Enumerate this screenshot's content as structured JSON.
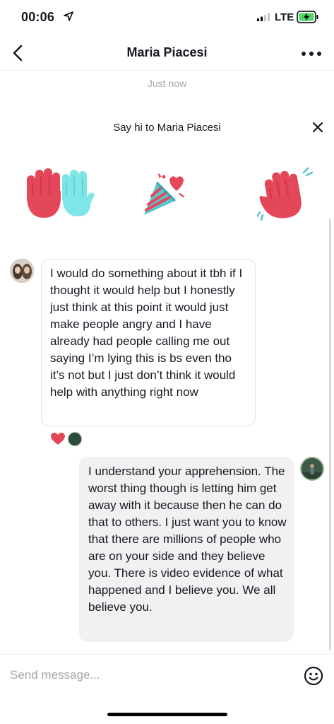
{
  "status_bar": {
    "time": "00:06",
    "network": "LTE",
    "icons": [
      "location-arrow-icon",
      "signal-icon",
      "battery-charging-icon"
    ]
  },
  "header": {
    "title": "Maria Piacesi",
    "back_icon": "chevron-left-icon",
    "more_icon": "ellipsis-icon"
  },
  "conversation": {
    "timestamp": "Just now",
    "say_hi": {
      "text": "Say hi to Maria Piacesi",
      "close_icon": "close-icon",
      "stickers": [
        "high-five-hands-sticker",
        "party-popper-sticker",
        "waving-hand-sticker"
      ]
    },
    "messages": [
      {
        "direction": "incoming",
        "text": "I would do something about it tbh if I thought it would help but I honestly just think at this point it would just make people angry and I have already had people calling me out saying I’m lying this is bs even tho it’s not but I just don’t think it would help with anything right now",
        "reactions": [
          "heart-icon",
          "avatar"
        ]
      },
      {
        "direction": "outgoing",
        "text": "I understand your apprehension. The worst thing though is letting him get away with it because then he can do that to others. I just want you to know that there are millions of people who are on your side and they believe you. There is video evidence of what happened and I believe you. We all believe you."
      }
    ]
  },
  "composer": {
    "placeholder": "Send message...",
    "value": "",
    "emoji_icon": "smiley-icon"
  },
  "colors": {
    "accent_red": "#e4465a",
    "accent_teal": "#7ee6e6",
    "bubble_out_bg": "#f1f1f2",
    "bubble_in_border": "#e3e3e6",
    "muted_text": "#a6a6ab"
  }
}
